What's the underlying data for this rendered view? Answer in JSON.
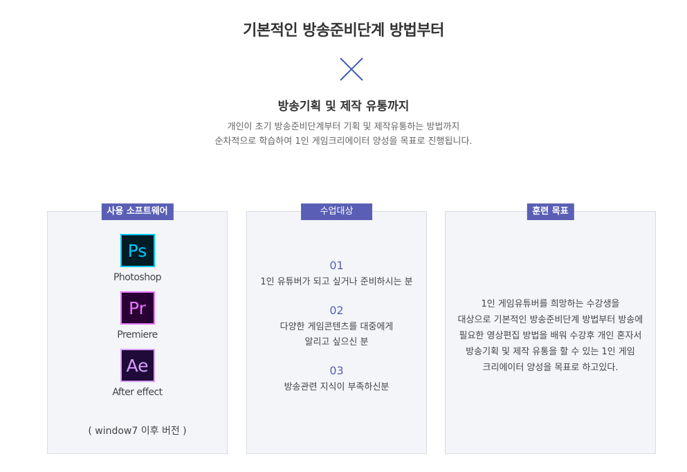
{
  "header": {
    "title": "기본적인 방송준비단계 방법부터",
    "subtitle": "방송기획 및 제작 유통까지",
    "desc_lines": [
      "개인이 초기 방송준비단계부터 기획 및 제작유통하는 방법까지",
      "순차적으로 학습하여 1인 게임크리에이터 양성을 목표로 진행됩니다."
    ],
    "accent_color": "#3b5bb0"
  },
  "software": {
    "label": "사용 소프트웨어",
    "items": [
      {
        "abbr": "Ps",
        "name": "Photoshop",
        "icon": "photoshop-icon"
      },
      {
        "abbr": "Pr",
        "name": "Premiere",
        "icon": "premiere-icon"
      },
      {
        "abbr": "Ae",
        "name": "After effect",
        "icon": "after-effects-icon"
      }
    ],
    "note": "( window7 이후 버전 )"
  },
  "target": {
    "label": "수업대상",
    "items": [
      {
        "num": "01",
        "lines": [
          "1인 유튜버가 되고 싶거나 준비하시는 분"
        ]
      },
      {
        "num": "02",
        "lines": [
          "다양한 게임콘텐츠를 대중에게",
          "알리고 싶으신 분"
        ]
      },
      {
        "num": "03",
        "lines": [
          "방송관련 지식이 부족하신분"
        ]
      }
    ]
  },
  "goal": {
    "label": "훈련 목표",
    "lines": [
      "1인 게임유튜버를 희망하는 수강생을",
      "대상으로 기본적인 방송준비단계 방법부터 방송에",
      "필요한 영상편집 방법을 배워 수강후 개인 혼자서",
      "방송기획 및 제작 유통을 할 수 있는 1인 게임",
      "크리에이터 양성을 목표로 하고있다."
    ]
  },
  "colors": {
    "label_bg": "#5a5fb5",
    "card_bg": "#f3f5f9"
  }
}
